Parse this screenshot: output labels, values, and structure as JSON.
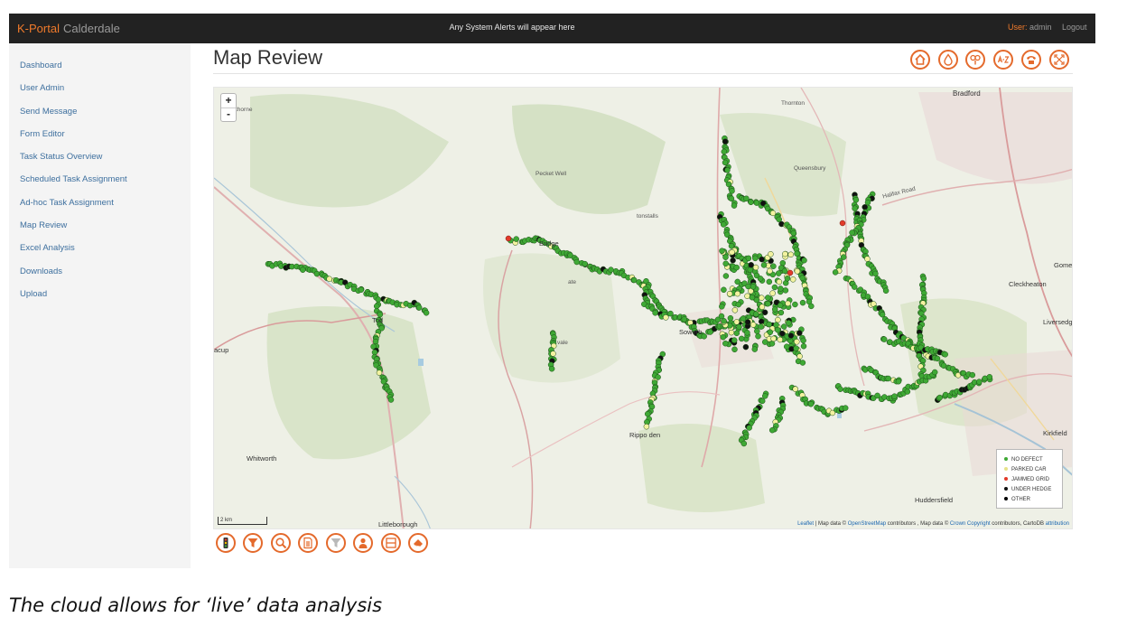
{
  "header": {
    "brand": "K-Portal",
    "org": "Calderdale",
    "alert": "Any System Alerts will appear here",
    "user_label": "User:",
    "user_name": "admin",
    "logout": "Logout"
  },
  "sidebar": {
    "items": [
      {
        "label": "Dashboard"
      },
      {
        "label": "User Admin"
      },
      {
        "label": "Send Message"
      },
      {
        "label": "Form Editor"
      },
      {
        "label": "Task Status Overview"
      },
      {
        "label": "Scheduled Task Assignment"
      },
      {
        "label": "Ad-hoc Task Assignment"
      },
      {
        "label": "Map Review"
      },
      {
        "label": "Excel Analysis"
      },
      {
        "label": "Downloads"
      },
      {
        "label": "Upload"
      }
    ]
  },
  "page": {
    "title": "Map Review"
  },
  "toolbar_icons": [
    "home-icon",
    "water-drop-icon",
    "multi-pin-icon",
    "a-z-icon",
    "phone-icon",
    "expand-icon"
  ],
  "bottom_icons": [
    "traffic-light-icon",
    "filter-icon",
    "zoom-search-icon",
    "document-icon",
    "filter-outline-icon",
    "person-icon",
    "panel-icon",
    "eraser-icon"
  ],
  "map": {
    "zoom_in": "+",
    "zoom_out": "-",
    "scale_label": "2 km",
    "attribution": {
      "leaflet": "Leaflet",
      "map_data_1": " | Map data © ",
      "osm": "OpenStreetMap",
      "contributors_1": " contributors , Map data © ",
      "crown": "Crown Copyright",
      "contributors_2": " contributors, CartoDB ",
      "attribution_word": "attribution"
    },
    "places": {
      "bradford": "Bradford",
      "pecket_well": "Pecket Well",
      "hebden_bridge": "Bridge",
      "todmorden": "Tod",
      "sowerby": "Sowerb",
      "ripponden": "Rippo    den",
      "whitworth": "Whitworth",
      "littleborough": "Littleborough",
      "huddersfield": "Huddersfield",
      "cleckheaton": "Cleckheaton",
      "liversedge": "Liversedg",
      "gomersal": "Gome",
      "kirkfield": "Kirkfield",
      "bacup": "acup",
      "heptonstall": "tonstalls",
      "thornton": "Thornton",
      "queensbury": "Queensbury",
      "halifax_road": "Halifax Road",
      "lthorne": "thorne",
      "midgehole": "ate",
      "mytholm": "vale"
    }
  },
  "legend": {
    "no_defect": "NO DEFECT",
    "parked_car": "PARKED CAR",
    "jammed_grid": "JAMMED GRID",
    "under_hedge": "UNDER HEDGE",
    "other": "OTHER"
  },
  "colors": {
    "accent": "#e46a2c",
    "no_defect": "#3fa935",
    "parked_car": "#f3f2a0",
    "jammed_grid": "#e23a2a",
    "under_hedge": "#111111",
    "other": "#000000"
  },
  "caption": "The cloud allows for ‘live’ data analysis"
}
